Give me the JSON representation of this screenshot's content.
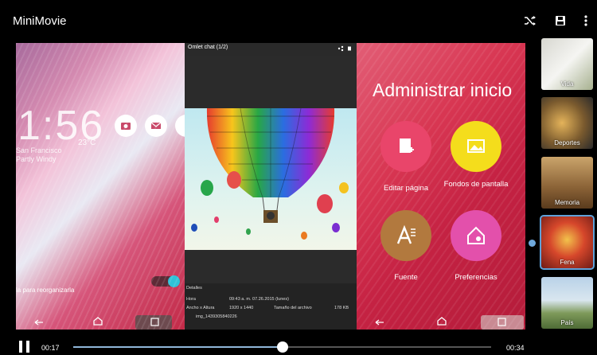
{
  "app": {
    "title": "MiniMovie",
    "icons": [
      "shuffle-icon",
      "save-icon",
      "more-vertical-icon"
    ]
  },
  "left_screen": {
    "clock": "1:56",
    "temperature": "23°C",
    "location": "San Francisco",
    "weather": "Partly Windy",
    "hint": "la para reorganizarla"
  },
  "middle_screen": {
    "header": "Omlet chat (1/2)",
    "details_title": "Detalles",
    "details": [
      {
        "k": "Hora",
        "v": "09:43 a. m. 07.26.2015 (lunes)"
      },
      {
        "k": "Ancho x Altura",
        "v": "1920 x 1440",
        "k2": "Tamaño del archivo",
        "v2": "178 KB"
      }
    ],
    "filename": "img_1439305840226"
  },
  "right_screen": {
    "title": "Administrar inicio",
    "buttons": [
      {
        "label": "Editar página",
        "color": "#e9456a"
      },
      {
        "label": "Fondos de pantalla",
        "color": "#f4dd1c"
      },
      {
        "label": "Fuente",
        "color": "#b2793e"
      },
      {
        "label": "Preferencias",
        "color": "#e350ab"
      }
    ]
  },
  "thumbnails": [
    {
      "label": "Vida",
      "selected": false
    },
    {
      "label": "Deportes",
      "selected": false
    },
    {
      "label": "Memoria",
      "selected": false
    },
    {
      "label": "Fena",
      "selected": true
    },
    {
      "label": "País",
      "selected": false
    }
  ],
  "player": {
    "current": "00:17",
    "total": "00:34",
    "progress": 0.5
  },
  "colors": {
    "accent": "#5ea1d9",
    "background": "#000000"
  }
}
